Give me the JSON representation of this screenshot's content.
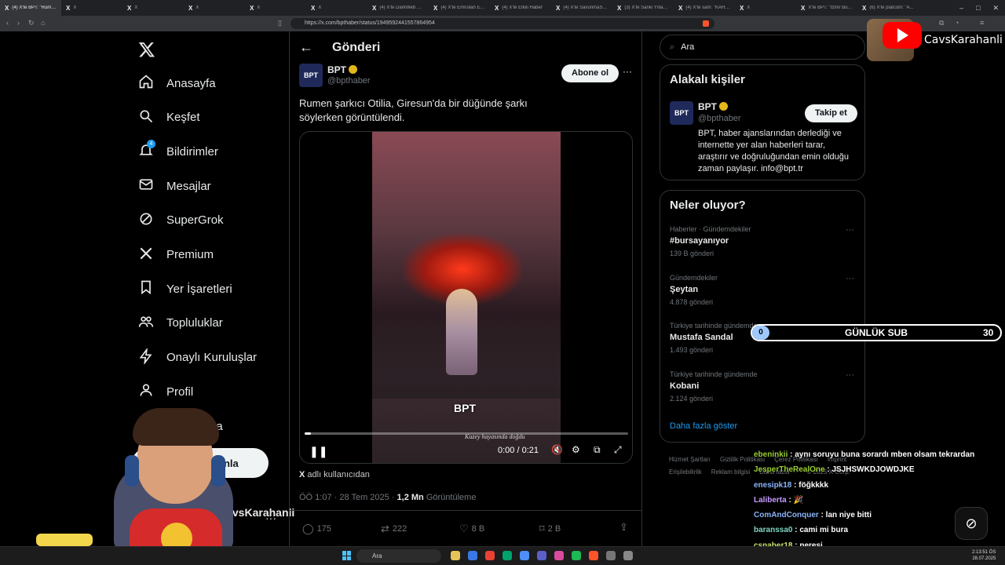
{
  "tabs": [
    {
      "label": "(4) X'te BPT: \"Rumen şarkıcı...",
      "active": true
    },
    {
      "label": "X"
    },
    {
      "label": "X"
    },
    {
      "label": "X"
    },
    {
      "label": "X"
    },
    {
      "label": "X"
    },
    {
      "label": "(4) X'te DarkWeb Haber"
    },
    {
      "label": "(4) X'te Emrullah Erdi"
    },
    {
      "label": "(4) X'te Etkili Haber"
    },
    {
      "label": "(4) X'te SavunmaSanayi"
    },
    {
      "label": "(3) X'te Sanki Yıllarca"
    },
    {
      "label": "(4) X'te sam: \"KAHI...\""
    },
    {
      "label": "X"
    },
    {
      "label": "X'te BPT: \"İzmir Buca\""
    },
    {
      "label": "(6) X'te platcom: \"A..."
    }
  ],
  "browser": {
    "url": "https://x.com/bpthaber/status/1949592441557864954"
  },
  "nav": {
    "items": [
      {
        "label": "Anasayfa",
        "icon": "home-icon"
      },
      {
        "label": "Keşfet",
        "icon": "search-icon"
      },
      {
        "label": "Bildirimler",
        "icon": "bell-icon",
        "badge": "4"
      },
      {
        "label": "Mesajlar",
        "icon": "mail-icon"
      },
      {
        "label": "SuperGrok",
        "icon": "grok-icon"
      },
      {
        "label": "Premium",
        "icon": "x-icon"
      },
      {
        "label": "Yer İşaretleri",
        "icon": "bookmark-icon"
      },
      {
        "label": "Topluluklar",
        "icon": "people-icon"
      },
      {
        "label": "Onaylı Kuruluşlar",
        "icon": "bolt-icon"
      },
      {
        "label": "Profil",
        "icon": "person-icon"
      },
      {
        "label": "Daha fazla",
        "icon": "more-icon"
      }
    ],
    "post_button": "Gönderi yayınla",
    "account_name": "CavsKarahanli"
  },
  "post": {
    "header_title": "Gönderi",
    "author_name": "BPT",
    "author_handle": "@bpthaber",
    "subscribe_label": "Abone ol",
    "text_line1": "Rumen şarkıcı Otilia, Giresun'da bir düğünde şarkı",
    "text_line2": "söylerken görüntülendi.",
    "video": {
      "time": "0:00 / 0:21",
      "progress": 0.02,
      "watermark": "BPT",
      "caption": "Kuzey hayasında doğdu"
    },
    "from_user_prefix": "X",
    "from_user_text": "adlı kullanıcıdan",
    "timestamp": "ÖÖ 1:07 · 28 Tem 2025 ·",
    "views_count": "1,2 Mn",
    "views_label": "Görüntüleme",
    "replies": "175",
    "reposts": "222",
    "likes": "8 B",
    "bookmarks": "2 B"
  },
  "search": {
    "placeholder": "Ara"
  },
  "related": {
    "title": "Alakalı kişiler",
    "name": "BPT",
    "handle": "@bpthaber",
    "follow_label": "Takip et",
    "bio_line1": "BPT, haber ajanslarından derlediği ve",
    "bio_line2": "internette yer alan haberleri tarar,",
    "bio_line3": "araştırır ve doğruluğundan emin olduğu",
    "bio_line4": "zaman paylaşır. info@bpt.tr"
  },
  "trends": {
    "title": "Neler oluyor?",
    "items": [
      {
        "context": "Haberler · Gündemdekiler",
        "name": "#bursayanıyor",
        "count": "139 B gönderi"
      },
      {
        "context": "Gündemdekiler",
        "name": "Şeytan",
        "count": "4.878 gönderi"
      },
      {
        "context": "Türkiye tarihinde gündemde",
        "name": "Mustafa Sandal",
        "count": "1.493 gönderi"
      },
      {
        "context": "Türkiye tarihinde gündemde",
        "name": "Kobani",
        "count": "2.124 gönderi"
      }
    ],
    "show_more": "Daha fazla göster"
  },
  "footer": {
    "links": [
      "Hizmet Şartları",
      "Gizlilik Politikası",
      "Çerez Politikası",
      "Imprint",
      "Erişilebilirlik",
      "Reklam bilgisi",
      "Daha fazla ···",
      "© 2025 X Corp."
    ]
  },
  "overlay": {
    "channel_name": "CavsKarahanli",
    "sub_label": "GÜNLÜK SUB",
    "sub_current": "0",
    "sub_goal": "30",
    "sub_progress": 0.0
  },
  "chat": [
    {
      "user": "ebeninkii",
      "color": "#9acd32",
      "msg": "aynı soruyu buna sorardı mben olsam tekrardan"
    },
    {
      "user": "JesperTheRealOne",
      "color": "#9acd32",
      "msg": "JSJHSWKDJOWDJKE"
    },
    {
      "user": "enesipk18",
      "color": "#8ab4f8",
      "msg": "föğkkkk"
    },
    {
      "user": "Laliberta",
      "color": "#c79bff",
      "msg": "🎉"
    },
    {
      "user": "ComAndConquer",
      "color": "#8ab4f8",
      "msg": "lan niye bitti"
    },
    {
      "user": "baranssa0",
      "color": "#7fd7c4",
      "msg": "cami mi bura"
    },
    {
      "user": "csnaber18",
      "color": "#c9e36b",
      "msg": "neresi"
    }
  ],
  "taskbar": {
    "search_placeholder": "Ara",
    "time": "2:13:51 ÖS",
    "date": "28.07.2025"
  }
}
